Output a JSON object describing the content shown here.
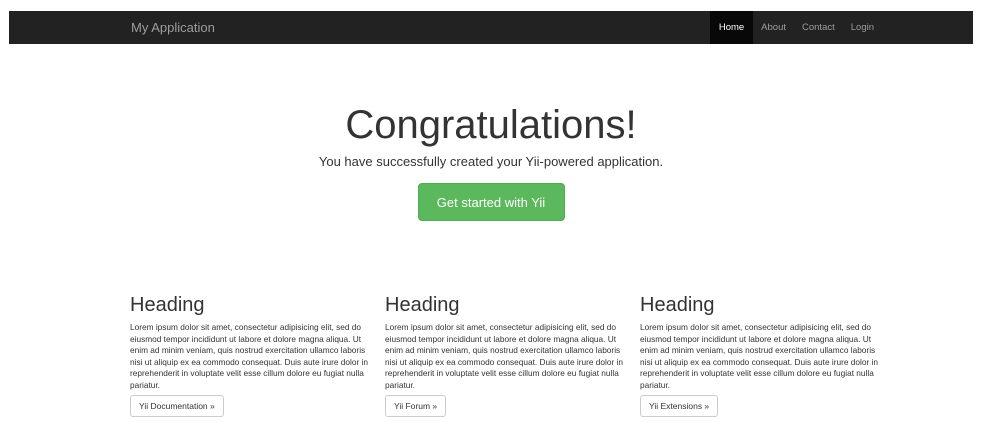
{
  "navbar": {
    "brand": "My Application",
    "items": [
      {
        "label": "Home"
      },
      {
        "label": "About"
      },
      {
        "label": "Contact"
      },
      {
        "label": "Login"
      }
    ]
  },
  "jumbotron": {
    "title": "Congratulations!",
    "lead": "You have successfully created your Yii-powered application.",
    "button_label": "Get started with Yii"
  },
  "columns": [
    {
      "heading": "Heading",
      "text": "Lorem ipsum dolor sit amet, consectetur adipisicing elit, sed do eiusmod tempor incididunt ut labore et dolore magna aliqua. Ut enim ad minim veniam, quis nostrud exercitation ullamco laboris nisi ut aliquip ex ea commodo consequat. Duis aute irure dolor in reprehenderit in voluptate velit esse cillum dolore eu fugiat nulla pariatur.",
      "button_label": "Yii Documentation »"
    },
    {
      "heading": "Heading",
      "text": "Lorem ipsum dolor sit amet, consectetur adipisicing elit, sed do eiusmod tempor incididunt ut labore et dolore magna aliqua. Ut enim ad minim veniam, quis nostrud exercitation ullamco laboris nisi ut aliquip ex ea commodo consequat. Duis aute irure dolor in reprehenderit in voluptate velit esse cillum dolore eu fugiat nulla pariatur.",
      "button_label": "Yii Forum »"
    },
    {
      "heading": "Heading",
      "text": "Lorem ipsum dolor sit amet, consectetur adipisicing elit, sed do eiusmod tempor incididunt ut labore et dolore magna aliqua. Ut enim ad minim veniam, quis nostrud exercitation ullamco laboris nisi ut aliquip ex ea commodo consequat. Duis aute irure dolor in reprehenderit in voluptate velit esse cillum dolore eu fugiat nulla pariatur.",
      "button_label": "Yii Extensions »"
    }
  ],
  "colors": {
    "navbar_bg": "#222222",
    "navbar_active_bg": "#080808",
    "success": "#5cb85c"
  }
}
